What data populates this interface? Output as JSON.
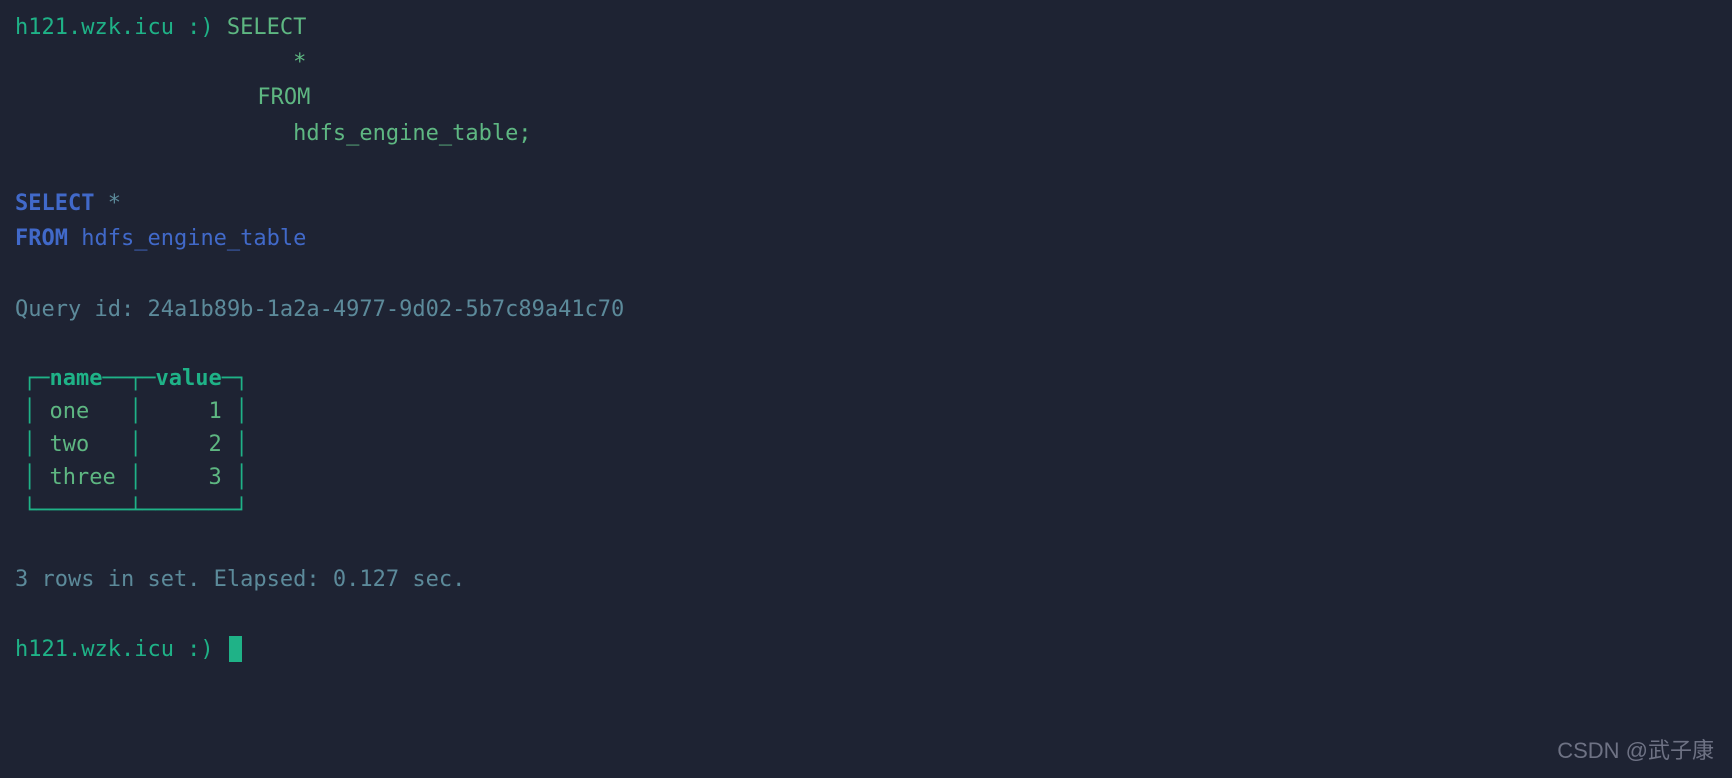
{
  "prompt": {
    "host": "h121.wzk.icu",
    "smiley": ":)",
    "full_prefix": "h121.wzk.icu :) "
  },
  "input_query": {
    "line1": "SELECT",
    "line2": "*",
    "line3": "FROM",
    "line4": "hdfs_engine_table;"
  },
  "parsed_query": {
    "select": "SELECT",
    "star": "*",
    "from": "FROM",
    "table": "hdfs_engine_table"
  },
  "query_id": {
    "label": "Query id:",
    "value": "24a1b89b-1a2a-4977-9d02-5b7c89a41c70"
  },
  "result": {
    "columns": [
      "name",
      "value"
    ],
    "rows": [
      {
        "name": "one",
        "value": "1"
      },
      {
        "name": "two",
        "value": "2"
      },
      {
        "name": "three",
        "value": "3"
      }
    ]
  },
  "status": {
    "text": "3 rows in set. Elapsed: 0.127 sec."
  },
  "watermark": "CSDN @武子康",
  "table_art": {
    "top": "┌─name──┬─value─┐",
    "r1": "│ one   │     1 │",
    "r2": "│ two   │     2 │",
    "r3": "│ three │     3 │",
    "bottom": "└───────┴───────┘"
  }
}
